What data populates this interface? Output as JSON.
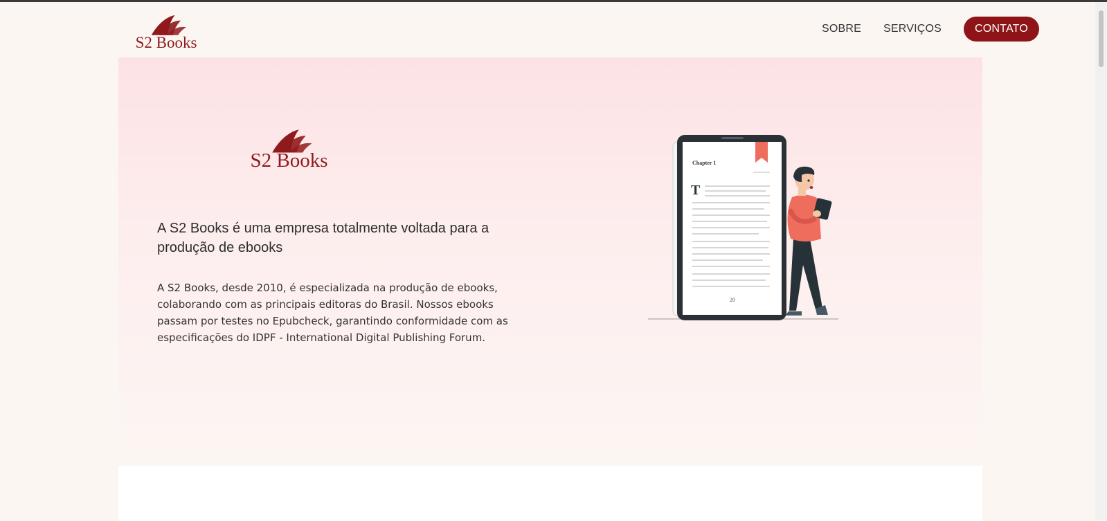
{
  "brand": {
    "name": "S2 Books",
    "color": "#8e1418"
  },
  "nav": {
    "items": [
      {
        "label": "SOBRE"
      },
      {
        "label": "SERVIÇOS"
      }
    ],
    "cta_label": "CONTATO"
  },
  "hero": {
    "title": "A S2 Books é uma empresa totalmente voltada para a produção de ebooks",
    "description": "A S2 Books, desde 2010, é especializada na produção de ebooks, colaborando com as principais editoras do Brasil. Nossos ebooks passam por testes no Epubcheck, garantindo conformidade com as especificações do IDPF - International Digital Publishing Forum.",
    "illustration": {
      "chapter_label": "Chapter 1",
      "drop_cap": "T",
      "page_number": "20"
    }
  }
}
